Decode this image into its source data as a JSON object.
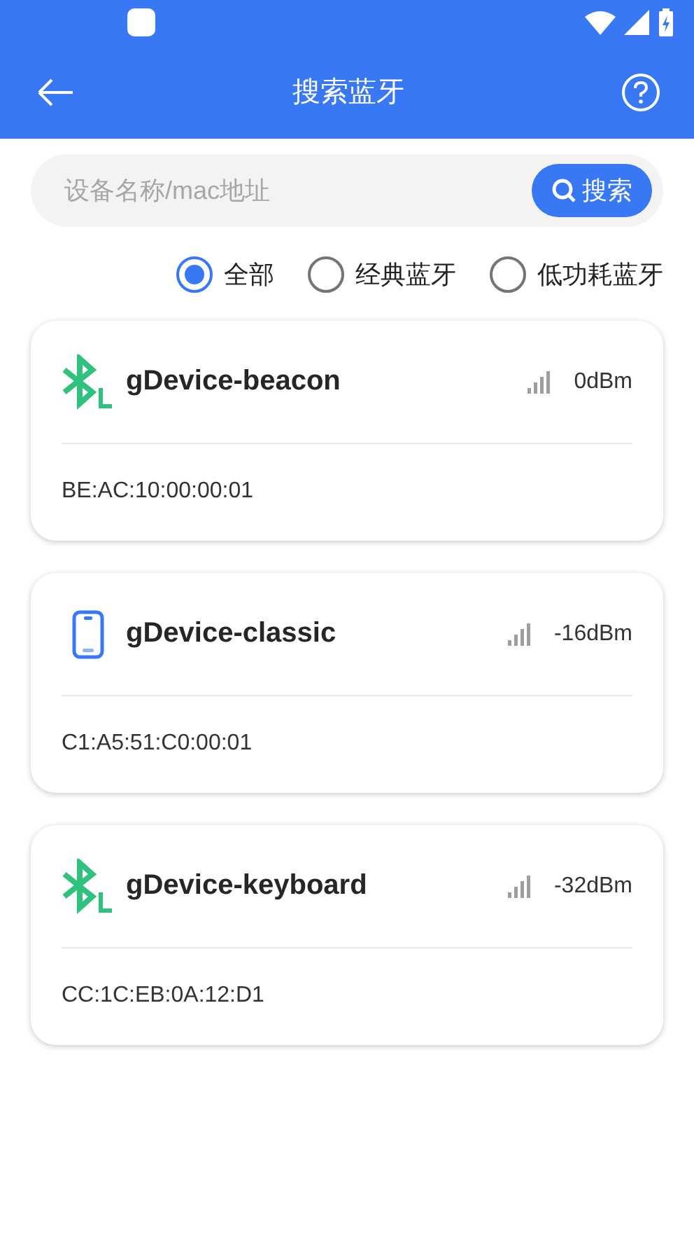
{
  "app_bar": {
    "title": "搜索蓝牙"
  },
  "search": {
    "placeholder": "设备名称/mac地址",
    "button": "搜索"
  },
  "filters": [
    {
      "label": "全部",
      "selected": true
    },
    {
      "label": "经典蓝牙",
      "selected": false
    },
    {
      "label": "低功耗蓝牙",
      "selected": false
    }
  ],
  "devices": [
    {
      "kind": "ble",
      "name": "gDevice-beacon",
      "signal": "0dBm",
      "mac": "BE:AC:10:00:00:01"
    },
    {
      "kind": "classic",
      "name": "gDevice-classic",
      "signal": "-16dBm",
      "mac": "C1:A5:51:C0:00:01"
    },
    {
      "kind": "ble",
      "name": "gDevice-keyboard",
      "signal": "-32dBm",
      "mac": "CC:1C:EB:0A:12:D1"
    }
  ]
}
